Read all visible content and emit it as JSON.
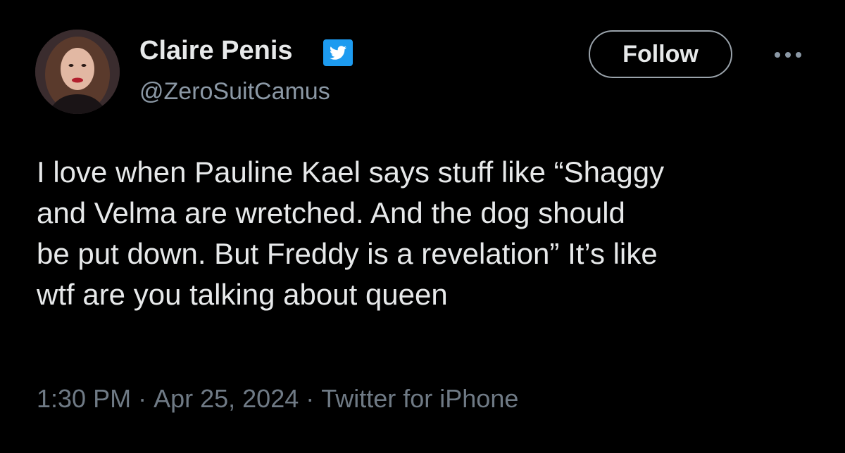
{
  "tweet": {
    "author": {
      "display_name": "Claire Penis",
      "handle": "@ZeroSuitCamus",
      "verified_icon": "twitter-bird-verified-icon",
      "avatar_icon": "profile-photo"
    },
    "follow_label": "Follow",
    "more_icon": "more-options-icon",
    "text_lines": [
      "I love when Pauline Kael says stuff like “Shaggy",
      "and Velma are wretched. And the dog should",
      "be put down. But Freddy is a revelation” It’s like",
      "wtf are you talking about queen"
    ],
    "time": "1:30 PM",
    "separator": "·",
    "date": "Apr 25, 2024",
    "source": "Twitter for iPhone"
  },
  "colors": {
    "background": "#000000",
    "primary_text": "#e7e9ea",
    "secondary_text": "#8b98a5",
    "meta_text": "#6f7a85",
    "verified_blue": "#1d9bf0"
  }
}
